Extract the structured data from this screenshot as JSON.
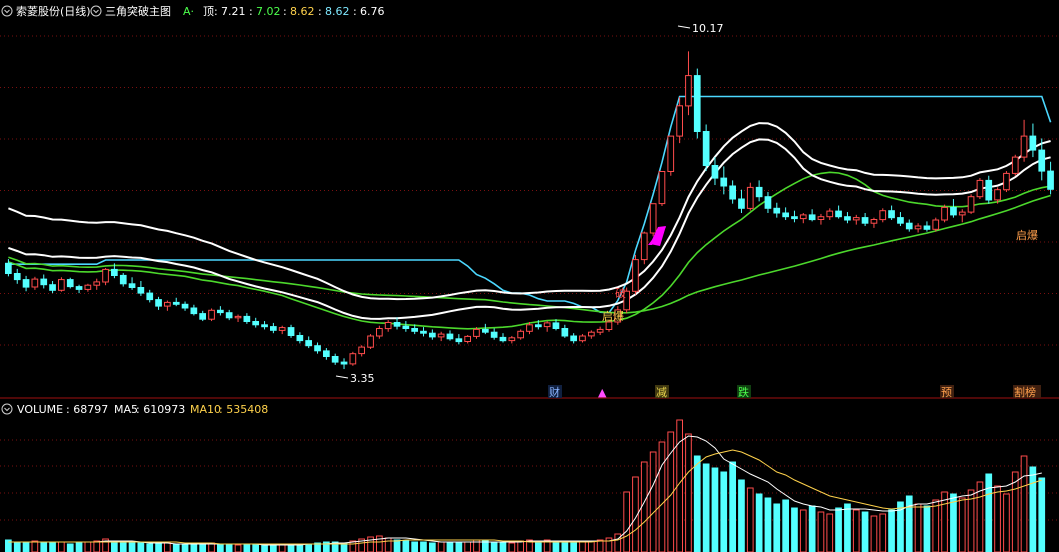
{
  "header": {
    "stock_name": "索菱股份",
    "period": "(日线)",
    "indicator_name": "三角突破主图",
    "indicator_flag": "A·",
    "value_label": "顶",
    "values": [
      "7.21",
      "7.02",
      "8.62",
      "8.62",
      "6.76"
    ],
    "value_colors": [
      "#ffffff",
      "#4cff4c",
      "#ffd24c",
      "#7fe8ff",
      "#ffffff"
    ],
    "separator": ":"
  },
  "annotations": {
    "high_price": "10.17",
    "low_price": "3.35",
    "signal_start": "启爆",
    "signal_start_2": "启爆",
    "signal_breakout": "破",
    "markers": [
      {
        "text": "财",
        "color": "#8ab4ff"
      },
      {
        "text": "▲",
        "color": "#ff4cff"
      },
      {
        "text": "减",
        "color": "#e8d44c"
      },
      {
        "text": "跌",
        "color": "#4cff4c"
      },
      {
        "text": "预",
        "color": "#ff9f4c"
      },
      {
        "text": "割榜",
        "color": "#ff9f4c"
      }
    ]
  },
  "volume_header": {
    "label": "VOLUME",
    "volume": "68797",
    "ma5_label": "MA5",
    "ma5": "610973",
    "ma10_label": "MA10",
    "ma10": "535408"
  },
  "colors": {
    "up": "#ff4c4c",
    "down": "#54ffff",
    "cyan_line": "#4cd8ff",
    "white_line": "#ffffff",
    "green_line": "#4cd82c",
    "grid": "#7a1010",
    "magenta": "#ff00ff"
  },
  "chart_data": {
    "type": "candlestick",
    "high": 10.17,
    "low": 3.35,
    "price_range": [
      2.9,
      10.8
    ],
    "candles": [
      [
        5.62,
        5.71,
        5.34,
        5.4
      ],
      [
        5.4,
        5.5,
        5.18,
        5.27
      ],
      [
        5.27,
        5.35,
        5.02,
        5.11
      ],
      [
        5.11,
        5.33,
        5.05,
        5.28
      ],
      [
        5.28,
        5.38,
        5.08,
        5.16
      ],
      [
        5.16,
        5.24,
        4.98,
        5.04
      ],
      [
        5.04,
        5.32,
        5.01,
        5.27
      ],
      [
        5.27,
        5.31,
        5.08,
        5.12
      ],
      [
        5.12,
        5.16,
        4.98,
        5.06
      ],
      [
        5.06,
        5.18,
        5.01,
        5.15
      ],
      [
        5.15,
        5.29,
        5.05,
        5.22
      ],
      [
        5.22,
        5.52,
        5.15,
        5.49
      ],
      [
        5.49,
        5.62,
        5.3,
        5.36
      ],
      [
        5.36,
        5.41,
        5.12,
        5.18
      ],
      [
        5.18,
        5.32,
        5.05,
        5.1
      ],
      [
        5.1,
        5.24,
        4.92,
        4.98
      ],
      [
        4.98,
        5.05,
        4.78,
        4.84
      ],
      [
        4.84,
        4.9,
        4.62,
        4.7
      ],
      [
        4.7,
        4.82,
        4.6,
        4.78
      ],
      [
        4.78,
        4.88,
        4.7,
        4.74
      ],
      [
        4.74,
        4.8,
        4.6,
        4.66
      ],
      [
        4.66,
        4.73,
        4.5,
        4.54
      ],
      [
        4.54,
        4.6,
        4.38,
        4.42
      ],
      [
        4.42,
        4.65,
        4.38,
        4.61
      ],
      [
        4.61,
        4.7,
        4.5,
        4.56
      ],
      [
        4.56,
        4.62,
        4.4,
        4.45
      ],
      [
        4.45,
        4.52,
        4.36,
        4.48
      ],
      [
        4.48,
        4.55,
        4.32,
        4.37
      ],
      [
        4.37,
        4.45,
        4.24,
        4.3
      ],
      [
        4.3,
        4.38,
        4.2,
        4.26
      ],
      [
        4.26,
        4.34,
        4.12,
        4.18
      ],
      [
        4.18,
        4.28,
        4.1,
        4.24
      ],
      [
        4.24,
        4.3,
        4.02,
        4.07
      ],
      [
        4.07,
        4.14,
        3.9,
        3.96
      ],
      [
        3.96,
        4.05,
        3.8,
        3.85
      ],
      [
        3.85,
        3.92,
        3.68,
        3.74
      ],
      [
        3.74,
        3.8,
        3.55,
        3.62
      ],
      [
        3.62,
        3.68,
        3.44,
        3.5
      ],
      [
        3.5,
        3.58,
        3.35,
        3.46
      ],
      [
        3.46,
        3.72,
        3.42,
        3.68
      ],
      [
        3.68,
        3.86,
        3.62,
        3.82
      ],
      [
        3.82,
        4.1,
        3.78,
        4.06
      ],
      [
        4.06,
        4.28,
        4.0,
        4.22
      ],
      [
        4.22,
        4.4,
        4.15,
        4.35
      ],
      [
        4.35,
        4.46,
        4.2,
        4.27
      ],
      [
        4.27,
        4.38,
        4.15,
        4.22
      ],
      [
        4.22,
        4.31,
        4.1,
        4.16
      ],
      [
        4.16,
        4.25,
        4.05,
        4.12
      ],
      [
        4.12,
        4.2,
        3.98,
        4.04
      ],
      [
        4.04,
        4.15,
        3.95,
        4.1
      ],
      [
        4.1,
        4.18,
        3.96,
        4.0
      ],
      [
        4.0,
        4.1,
        3.88,
        3.94
      ],
      [
        3.94,
        4.08,
        3.9,
        4.05
      ],
      [
        4.05,
        4.25,
        4.0,
        4.2
      ],
      [
        4.2,
        4.32,
        4.1,
        4.14
      ],
      [
        4.14,
        4.22,
        3.98,
        4.03
      ],
      [
        4.03,
        4.12,
        3.92,
        3.96
      ],
      [
        3.96,
        4.06,
        3.9,
        4.02
      ],
      [
        4.02,
        4.2,
        3.98,
        4.16
      ],
      [
        4.16,
        4.36,
        4.1,
        4.3
      ],
      [
        4.3,
        4.4,
        4.2,
        4.26
      ],
      [
        4.26,
        4.38,
        4.15,
        4.34
      ],
      [
        4.34,
        4.42,
        4.18,
        4.22
      ],
      [
        4.22,
        4.3,
        4.02,
        4.06
      ],
      [
        4.06,
        4.12,
        3.9,
        3.96
      ],
      [
        3.96,
        4.1,
        3.92,
        4.06
      ],
      [
        4.06,
        4.18,
        4.0,
        4.14
      ],
      [
        4.14,
        4.26,
        4.08,
        4.2
      ],
      [
        4.2,
        4.4,
        4.15,
        4.36
      ],
      [
        4.36,
        4.7,
        4.3,
        4.62
      ],
      [
        4.62,
        5.1,
        4.55,
        5.02
      ],
      [
        5.02,
        5.8,
        4.95,
        5.7
      ],
      [
        5.7,
        6.3,
        5.6,
        6.27
      ],
      [
        6.27,
        6.9,
        6.2,
        6.9
      ],
      [
        6.9,
        7.59,
        6.85,
        7.59
      ],
      [
        7.59,
        8.35,
        7.5,
        8.35
      ],
      [
        8.35,
        9.19,
        8.2,
        9.0
      ],
      [
        9.0,
        10.17,
        8.8,
        9.65
      ],
      [
        9.65,
        9.8,
        8.3,
        8.45
      ],
      [
        8.45,
        8.6,
        7.6,
        7.72
      ],
      [
        7.72,
        7.9,
        7.3,
        7.45
      ],
      [
        7.45,
        7.7,
        7.1,
        7.28
      ],
      [
        7.28,
        7.4,
        6.9,
        7.0
      ],
      [
        7.0,
        7.2,
        6.7,
        6.8
      ],
      [
        6.8,
        7.35,
        6.75,
        7.25
      ],
      [
        7.25,
        7.4,
        6.95,
        7.05
      ],
      [
        7.05,
        7.15,
        6.7,
        6.8
      ],
      [
        6.8,
        6.92,
        6.6,
        6.7
      ],
      [
        6.7,
        6.82,
        6.55,
        6.62
      ],
      [
        6.62,
        6.75,
        6.5,
        6.58
      ],
      [
        6.58,
        6.7,
        6.48,
        6.66
      ],
      [
        6.66,
        6.78,
        6.52,
        6.56
      ],
      [
        6.56,
        6.68,
        6.45,
        6.62
      ],
      [
        6.62,
        6.8,
        6.55,
        6.74
      ],
      [
        6.74,
        6.86,
        6.58,
        6.62
      ],
      [
        6.62,
        6.72,
        6.48,
        6.55
      ],
      [
        6.55,
        6.66,
        6.45,
        6.6
      ],
      [
        6.6,
        6.7,
        6.42,
        6.48
      ],
      [
        6.48,
        6.6,
        6.38,
        6.56
      ],
      [
        6.56,
        6.8,
        6.5,
        6.75
      ],
      [
        6.75,
        6.86,
        6.55,
        6.6
      ],
      [
        6.6,
        6.72,
        6.42,
        6.48
      ],
      [
        6.48,
        6.56,
        6.3,
        6.36
      ],
      [
        6.36,
        6.48,
        6.28,
        6.42
      ],
      [
        6.42,
        6.52,
        6.3,
        6.35
      ],
      [
        6.35,
        6.6,
        6.3,
        6.55
      ],
      [
        6.55,
        6.88,
        6.5,
        6.82
      ],
      [
        6.82,
        7.0,
        6.6,
        6.66
      ],
      [
        6.66,
        6.78,
        6.5,
        6.72
      ],
      [
        6.72,
        7.1,
        6.68,
        7.05
      ],
      [
        7.05,
        7.45,
        7.0,
        7.4
      ],
      [
        7.4,
        7.5,
        6.9,
        6.98
      ],
      [
        6.98,
        7.25,
        6.9,
        7.2
      ],
      [
        7.2,
        7.6,
        7.15,
        7.55
      ],
      [
        7.55,
        7.95,
        7.5,
        7.9
      ],
      [
        7.9,
        8.7,
        7.8,
        8.35
      ],
      [
        8.35,
        8.62,
        7.9,
        8.05
      ],
      [
        8.05,
        8.3,
        7.4,
        7.6
      ],
      [
        7.6,
        7.8,
        7.1,
        7.21
      ]
    ],
    "volume": [
      12,
      10,
      9,
      11,
      10,
      9,
      10,
      8,
      9,
      10,
      11,
      13,
      11,
      10,
      9,
      9,
      8,
      8,
      9,
      8,
      8,
      9,
      8,
      9,
      8,
      8,
      7,
      8,
      7,
      7,
      7,
      8,
      7,
      8,
      8,
      9,
      10,
      10,
      9,
      11,
      13,
      15,
      16,
      14,
      12,
      11,
      10,
      10,
      9,
      10,
      9,
      9,
      10,
      12,
      11,
      10,
      9,
      9,
      11,
      12,
      11,
      12,
      11,
      10,
      9,
      10,
      11,
      12,
      14,
      18,
      60,
      75,
      90,
      100,
      110,
      120,
      132,
      118,
      96,
      88,
      84,
      80,
      90,
      72,
      64,
      58,
      54,
      48,
      52,
      44,
      42,
      46,
      40,
      38,
      44,
      48,
      42,
      40,
      36,
      38,
      42,
      50,
      56,
      48,
      46,
      52,
      60,
      58,
      54,
      62,
      70,
      78,
      66,
      58,
      80,
      96,
      85,
      74
    ],
    "ma5_volume": [
      10,
      10,
      10,
      10,
      10,
      10,
      10,
      10,
      10,
      10,
      10,
      11,
      11,
      11,
      11,
      10,
      9,
      9,
      9,
      8,
      8,
      8,
      8,
      8,
      8,
      8,
      8,
      8,
      8,
      7,
      7,
      7,
      7,
      7,
      8,
      8,
      8,
      9,
      9,
      10,
      11,
      12,
      13,
      14,
      14,
      14,
      13,
      12,
      11,
      10,
      10,
      10,
      10,
      10,
      10,
      10,
      10,
      10,
      10,
      11,
      11,
      11,
      11,
      11,
      11,
      11,
      11,
      11,
      11,
      13,
      21,
      34,
      50,
      67,
      87,
      99,
      110,
      116,
      115,
      111,
      104,
      93,
      88,
      83,
      78,
      74,
      70,
      63,
      57,
      51,
      48,
      46,
      45,
      42,
      42,
      43,
      43,
      43,
      42,
      41,
      41,
      42,
      46,
      48,
      48,
      50,
      52,
      54,
      56,
      57,
      61,
      64,
      65,
      66,
      70,
      76,
      77,
      79
    ],
    "ma10_volume": [
      10,
      10,
      10,
      10,
      10,
      10,
      10,
      10,
      10,
      10,
      10,
      10,
      10,
      10,
      10,
      10,
      10,
      10,
      10,
      10,
      9,
      9,
      9,
      9,
      8,
      8,
      8,
      8,
      8,
      8,
      8,
      8,
      8,
      8,
      8,
      8,
      8,
      8,
      8,
      8,
      9,
      10,
      10,
      11,
      11,
      12,
      12,
      12,
      12,
      12,
      12,
      12,
      12,
      12,
      12,
      12,
      11,
      11,
      11,
      10,
      10,
      10,
      10,
      10,
      10,
      10,
      10,
      11,
      11,
      12,
      16,
      22,
      30,
      39,
      48,
      57,
      69,
      80,
      88,
      95,
      98,
      100,
      102,
      100,
      96,
      92,
      86,
      80,
      77,
      72,
      68,
      64,
      60,
      56,
      54,
      52,
      50,
      48,
      46,
      44,
      43,
      44,
      45,
      45,
      45,
      46,
      48,
      50,
      52,
      53,
      55,
      58,
      60,
      61,
      63,
      66,
      69,
      72
    ]
  }
}
